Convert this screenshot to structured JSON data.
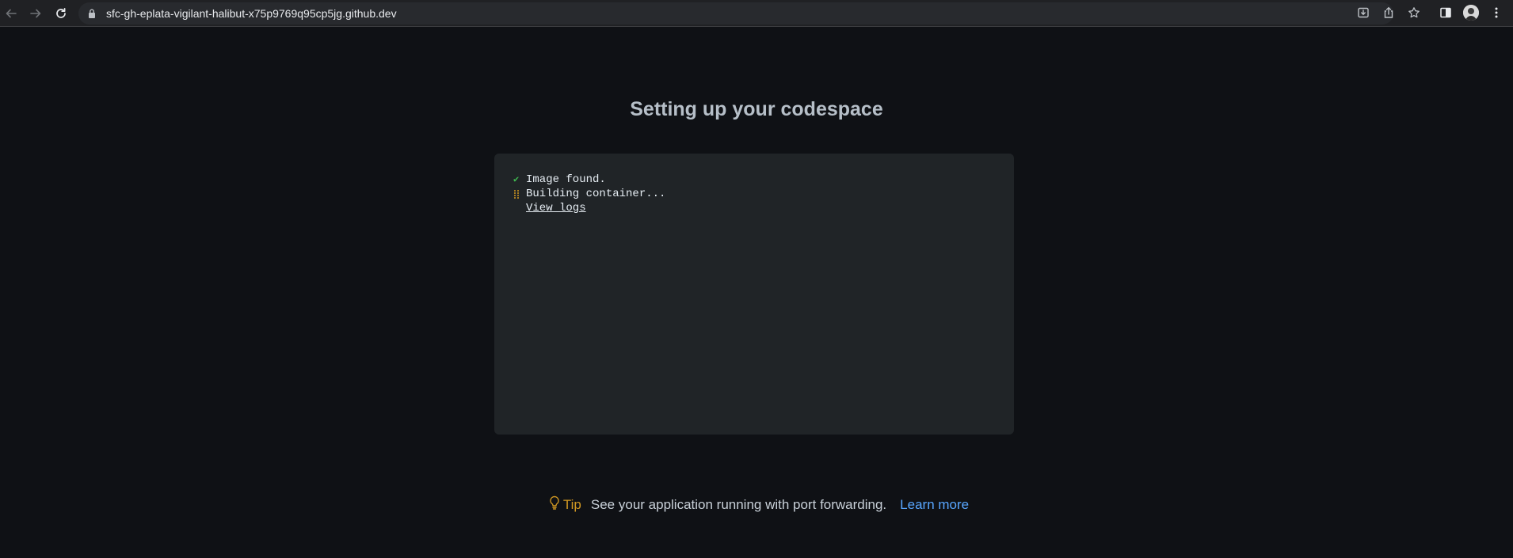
{
  "browser": {
    "url": "sfc-gh-eplata-vigilant-halibut-x75p9769q95cp5jg.github.dev",
    "icons": [
      "back-icon",
      "forward-icon",
      "reload-icon",
      "lock-icon",
      "install-icon",
      "share-icon",
      "bookmark-star-icon",
      "side-panel-icon",
      "profile-avatar",
      "menu-kebab-icon"
    ]
  },
  "page": {
    "title": "Setting up your codespace"
  },
  "log": {
    "lines": [
      {
        "status": "done",
        "icon": "check-icon",
        "text": "Image found."
      },
      {
        "status": "in-progress",
        "icon": "spinner-icon",
        "text": "Building container..."
      }
    ],
    "view_logs_label": "View logs"
  },
  "tip": {
    "label": "Tip",
    "text": "See your application running with port forwarding.",
    "link_label": "Learn more"
  },
  "colors": {
    "background": "#0f1115",
    "panel": "#202427",
    "success": "#3fb950",
    "warning": "#d29922",
    "link": "#58a6ff"
  }
}
